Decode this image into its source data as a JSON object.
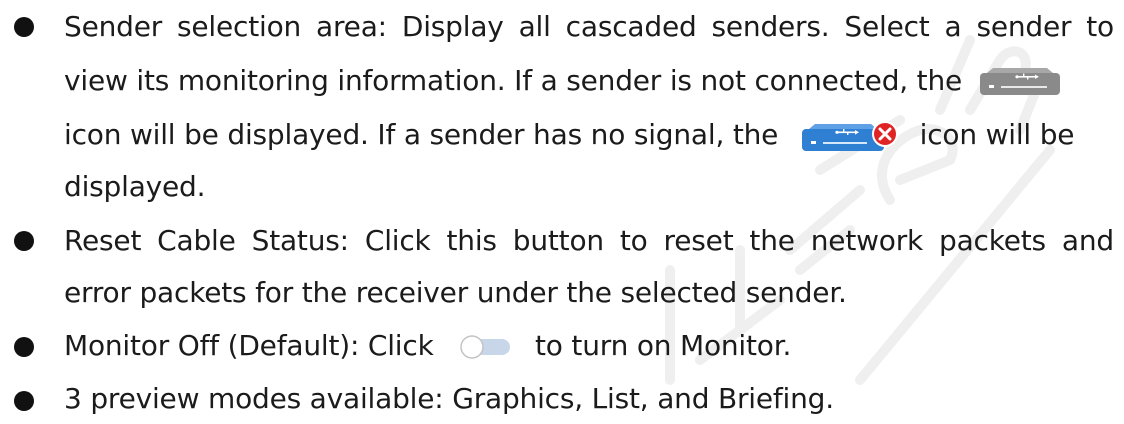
{
  "bullets": [
    {
      "lines": [
        "Sender selection area: Display all cascaded senders. Select a sender to",
        "view its monitoring information. If a sender is not connected, the",
        "icon will be displayed. If a sender has no signal, the",
        "icon will be",
        "displayed."
      ]
    },
    {
      "lines": [
        "Reset Cable Status: Click this button to reset the network packets and",
        "error packets for the receiver under the selected sender."
      ]
    },
    {
      "lines": [
        "Monitor Off (Default): Click",
        "to turn on Monitor."
      ]
    },
    {
      "lines": [
        "3 preview modes available: Graphics, List, and Briefing."
      ]
    }
  ],
  "icons": {
    "sender_disconnected": "sender-disconnected-icon",
    "sender_no_signal": "sender-no-signal-icon",
    "monitor_toggle": "toggle-off-icon"
  },
  "colors": {
    "disconnected_gray": "#8a8a8a",
    "no_signal_blue": "#2f7fd3",
    "error_red": "#e02424",
    "toggle_track": "#c8d6ea",
    "watermark": "#d6d6d6"
  }
}
